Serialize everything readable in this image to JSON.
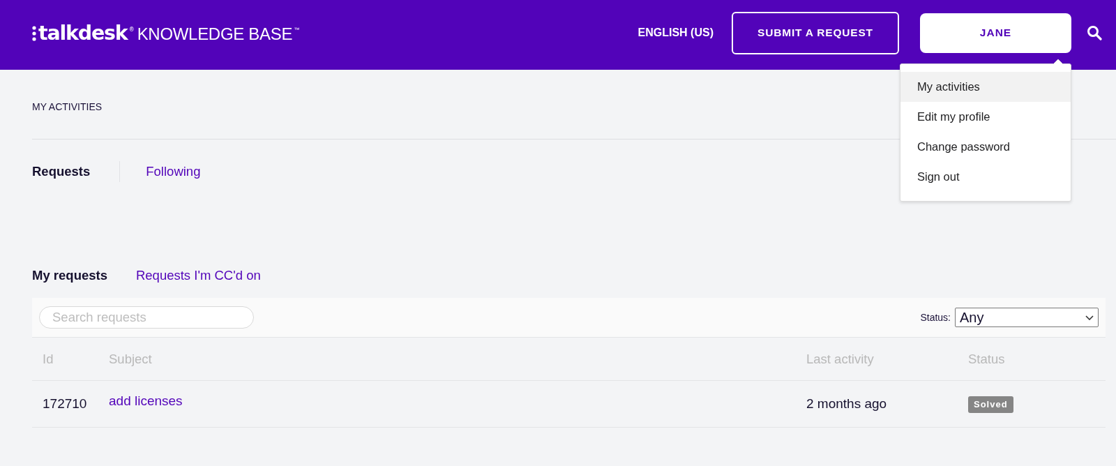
{
  "header": {
    "logo": {
      "brand": "talkdesk$^{®}$",
      "product": "KNOWLEDGE BASE$^{™}$"
    },
    "language": "ENGLISH (US)",
    "submit_button": "SUBMIT A REQUEST",
    "user_button": "JANE",
    "user_menu": {
      "expanded": true,
      "items": [
        {
          "label": "My activities",
          "selected": true
        },
        {
          "label": "Edit my profile",
          "selected": false
        },
        {
          "label": "Change password",
          "selected": false
        },
        {
          "label": "Sign out",
          "selected": false
        }
      ]
    }
  },
  "breadcrumb": "MY ACTIVITIES",
  "section_tabs": [
    {
      "label": "Requests",
      "selected": true
    },
    {
      "label": "Following",
      "selected": false
    }
  ],
  "request_tabs": [
    {
      "label": "My requests",
      "selected": true
    },
    {
      "label": "Requests I'm CC'd on",
      "selected": false
    }
  ],
  "filter": {
    "search": {
      "placeholder": "Search requests"
    },
    "status_label": "Status:",
    "status_value": "Any"
  },
  "table": {
    "columns": [
      "Id",
      "Subject",
      "Last activity",
      "Status"
    ],
    "rows": [
      {
        "id": "172710",
        "subject": "add licenses",
        "last_activity": "2 months ago",
        "status": "Solved"
      }
    ]
  }
}
